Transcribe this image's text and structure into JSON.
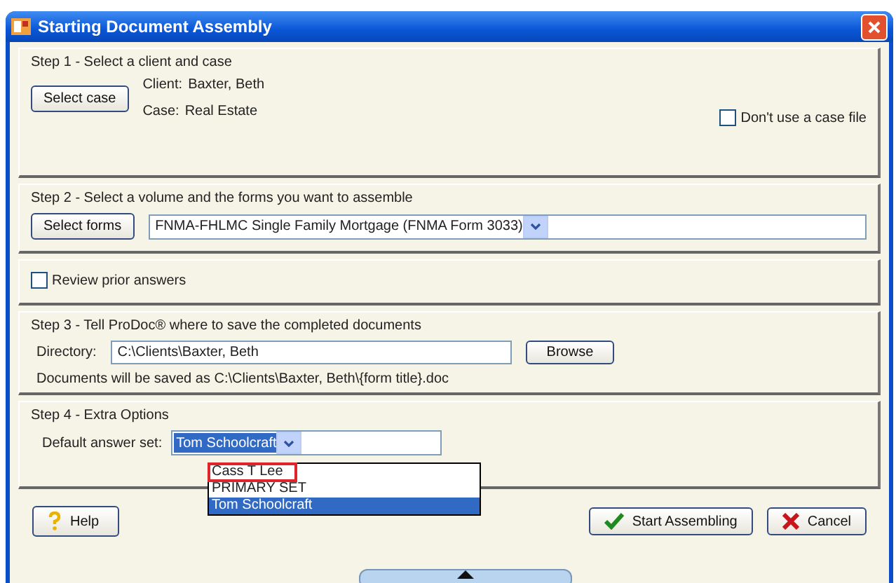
{
  "window": {
    "title": "Starting Document Assembly"
  },
  "step1": {
    "heading": "Step 1 - Select a client and case",
    "button": "Select case",
    "client_label": "Client:",
    "client": "Baxter, Beth",
    "case_label": "Case:",
    "case": "Real Estate",
    "no_case_file": {
      "label": "Don't use a case file",
      "checked": false
    }
  },
  "step2": {
    "heading": "Step 2 - Select a volume and the forms you want to assemble",
    "button": "Select forms",
    "volume": "FNMA-FHLMC Single Family Mortgage (FNMA Form 3033)"
  },
  "review": {
    "label": "Review prior answers",
    "checked": false
  },
  "step3": {
    "heading": "Step 3 - Tell ProDoc® where to save the completed documents",
    "directory_label": "Directory:",
    "directory": "C:\\Clients\\Baxter, Beth",
    "browse": "Browse",
    "note": "Documents will be saved as C:\\Clients\\Baxter, Beth\\{form title}.doc"
  },
  "step4": {
    "heading": "Step 4 - Extra Options",
    "answer_set_label": "Default answer set:",
    "answer_set": "Tom Schoolcraft",
    "options": [
      {
        "label": "Cass T Lee",
        "selected": false,
        "outlined": true
      },
      {
        "label": "PRIMARY SET",
        "selected": false,
        "outlined": false
      },
      {
        "label": "Tom Schoolcraft",
        "selected": true,
        "outlined": false
      }
    ]
  },
  "buttons": [
    {
      "kind": "help",
      "label": "Help"
    },
    {
      "kind": "start",
      "label": "Start Assembling"
    },
    {
      "kind": "cancel",
      "label": "Cancel"
    }
  ]
}
